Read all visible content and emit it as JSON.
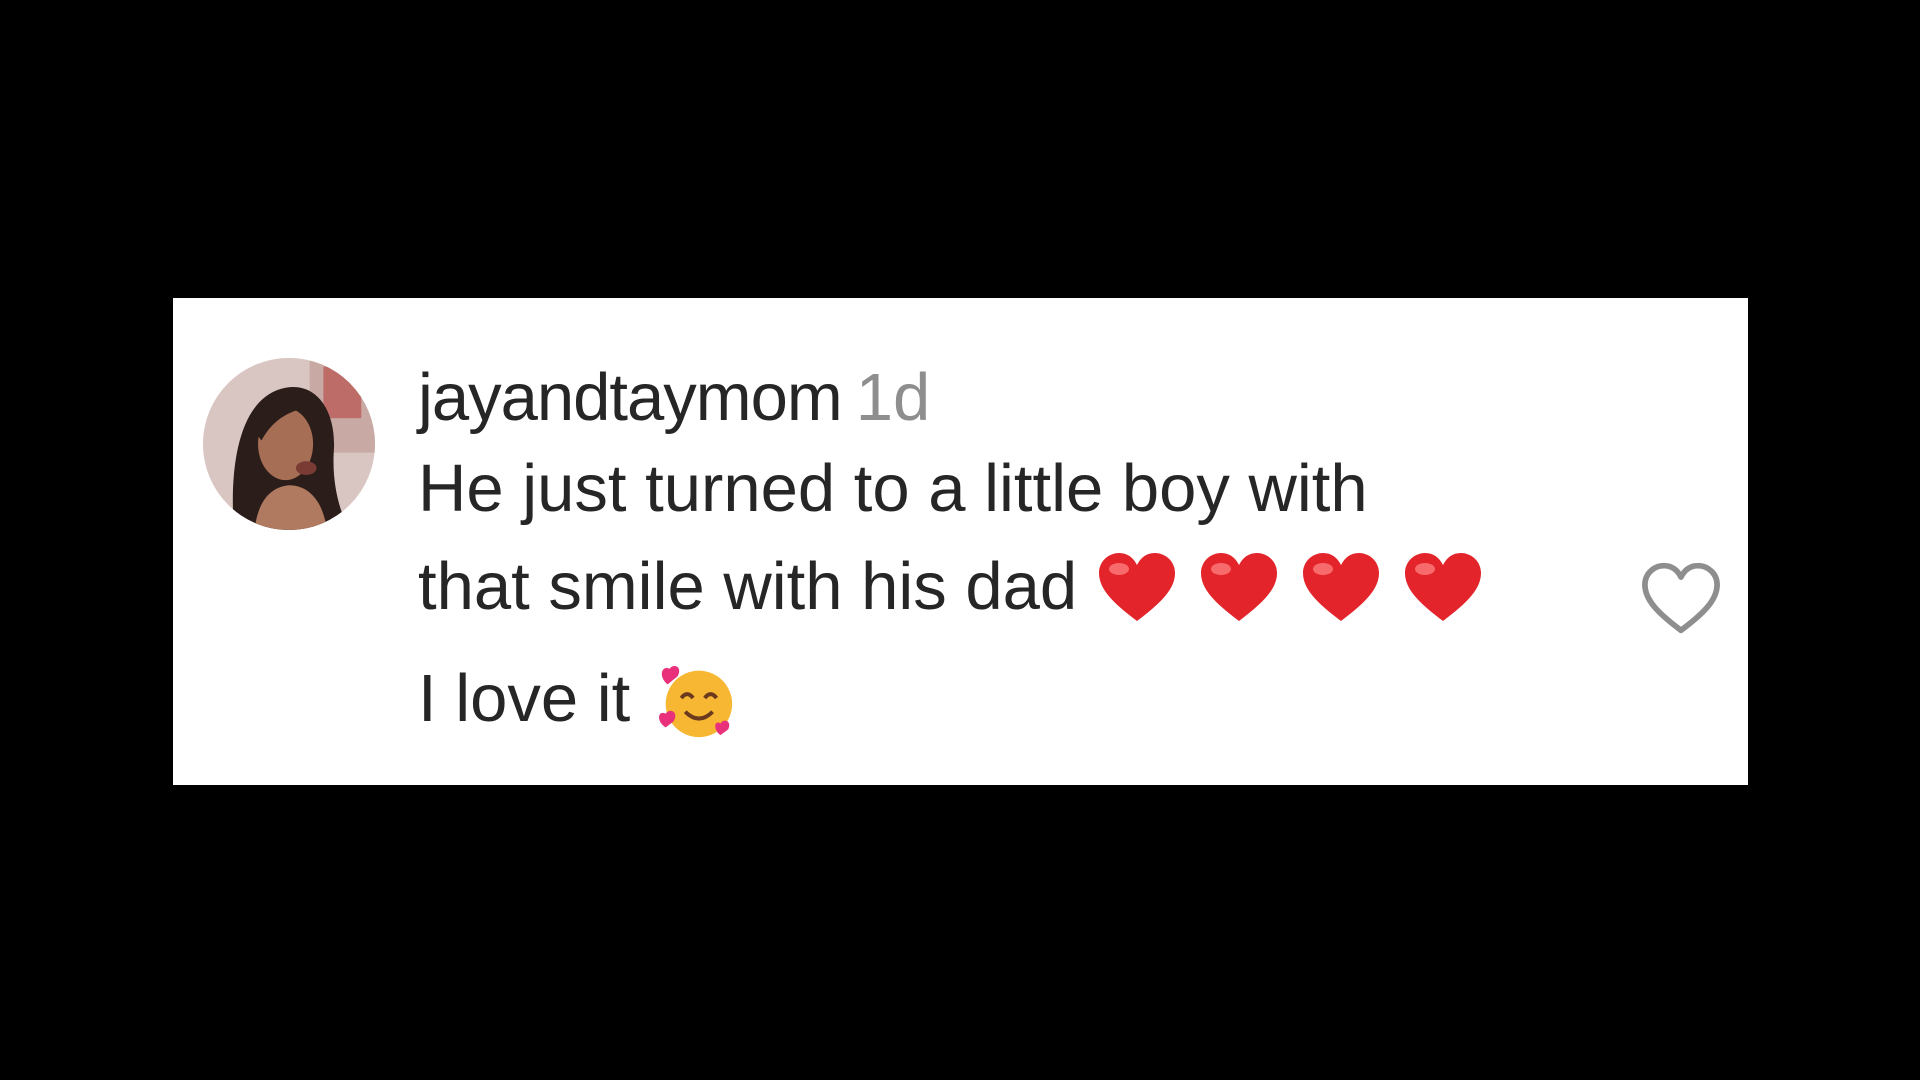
{
  "comment": {
    "username": "jayandtaymom",
    "timestamp": "1d",
    "text_line1": "He just turned to a little boy with",
    "text_line2": "that smile with his dad",
    "text_line3": "I love it",
    "emojis": [
      "red-heart-icon",
      "red-heart-icon",
      "red-heart-icon",
      "red-heart-icon",
      "smiling-face-with-hearts-icon"
    ]
  },
  "colors": {
    "background": "#000000",
    "card": "#ffffff",
    "text": "#262626",
    "muted": "#8e8e8e",
    "heart": "#e3242b",
    "like_outline": "#8e8e8e"
  }
}
